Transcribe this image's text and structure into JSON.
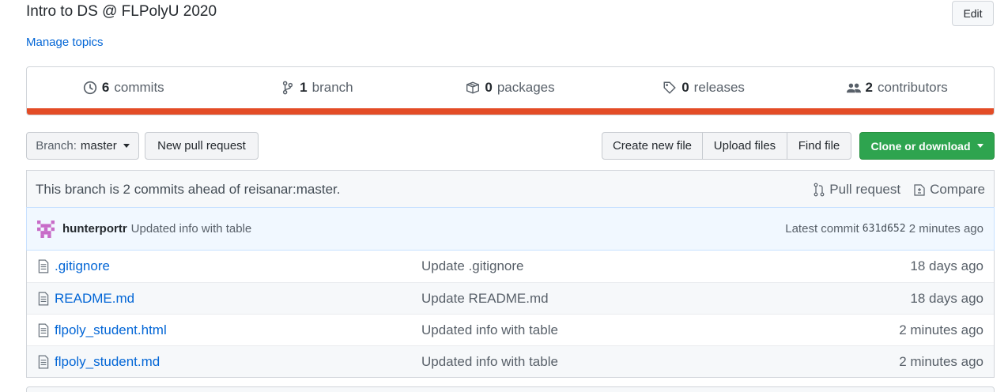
{
  "repo": {
    "description": "Intro to DS @ FLPolyU 2020",
    "manage_topics": "Manage topics",
    "edit_label": "Edit"
  },
  "summary": {
    "commits": {
      "count": "6",
      "label": "commits"
    },
    "branches": {
      "count": "1",
      "label": "branch"
    },
    "packages": {
      "count": "0",
      "label": "packages"
    },
    "releases": {
      "count": "0",
      "label": "releases"
    },
    "contributors": {
      "count": "2",
      "label": "contributors"
    },
    "language_bar_color": "#e34c26"
  },
  "toolbar": {
    "branch_prefix": "Branch:",
    "branch_name": "master",
    "new_pull_request": "New pull request",
    "create_new_file": "Create new file",
    "upload_files": "Upload files",
    "find_file": "Find file",
    "clone_or_download": "Clone or download"
  },
  "branch_status": {
    "text": "This branch is 2 commits ahead of reisanar:master.",
    "pull_request": "Pull request",
    "compare": "Compare"
  },
  "latest_commit": {
    "author": "hunterportr",
    "message": "Updated info with table",
    "label": "Latest commit",
    "sha": "631d652",
    "age": "2 minutes ago"
  },
  "files": [
    {
      "name": ".gitignore",
      "message": "Update .gitignore",
      "age": "18 days ago",
      "icon": "file-icon"
    },
    {
      "name": "README.md",
      "message": "Update README.md",
      "age": "18 days ago",
      "icon": "file-icon"
    },
    {
      "name": "flpoly_student.html",
      "message": "Updated info with table",
      "age": "2 minutes ago",
      "icon": "file-icon"
    },
    {
      "name": "flpoly_student.md",
      "message": "Updated info with table",
      "age": "2 minutes ago",
      "icon": "file-icon"
    }
  ],
  "colors": {
    "accent_link": "#0366d6",
    "clone_button": "#2ea44f",
    "commit_bar_bg": "#f1f8ff"
  }
}
